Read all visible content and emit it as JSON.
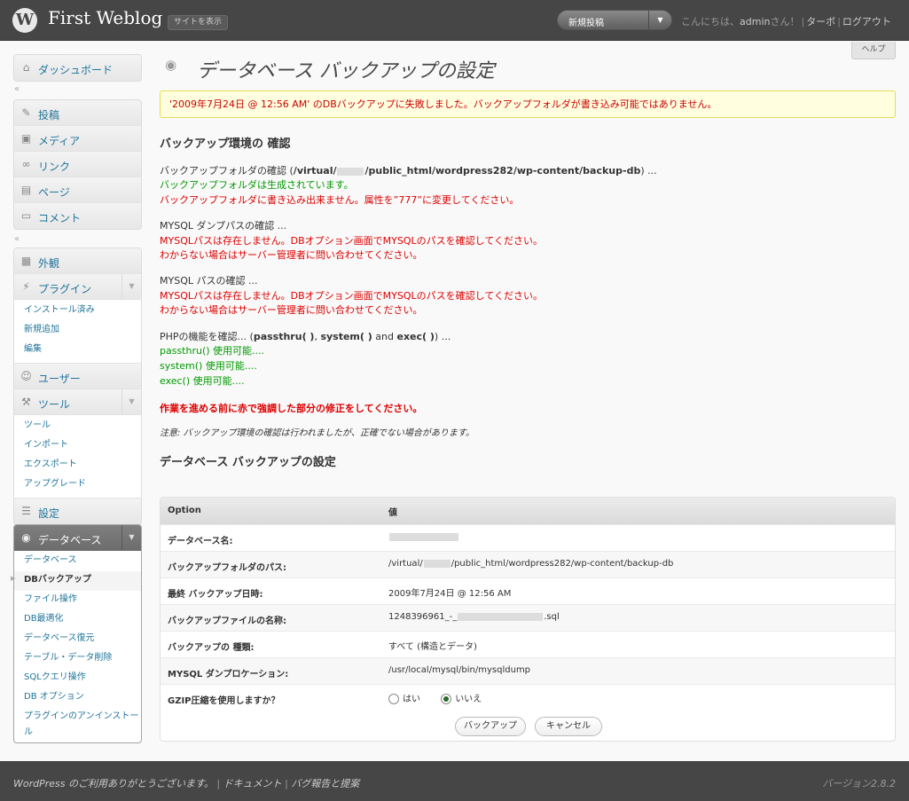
{
  "header": {
    "site_title": "First Weblog",
    "visit_site": "サイトを表示",
    "favorite_action": "新規投稿",
    "greeting_prefix": "こんにちは、",
    "username": "admin",
    "greeting_suffix": "さん！",
    "turbo": "ターボ",
    "logout": "ログアウト"
  },
  "help": "ヘルプ",
  "menu": {
    "dashboard": "ダッシュボード",
    "posts": "投稿",
    "media": "メディア",
    "links": "リンク",
    "pages": "ページ",
    "comments": "コメント",
    "appearance": "外観",
    "plugins": "プラグイン",
    "plugins_sub": [
      "インストール済み",
      "新規追加",
      "編集"
    ],
    "users": "ユーザー",
    "tools": "ツール",
    "tools_sub": [
      "ツール",
      "インポート",
      "エクスポート",
      "アップグレード"
    ],
    "settings": "設定",
    "database": "データベース",
    "database_sub": [
      "データベース",
      "DBバックアップ",
      "ファイル操作",
      "DB最適化",
      "データベース復元",
      "テーブル・データ削除",
      "SQLクエリ操作",
      "DB オプション",
      "プラグインのアンインストール"
    ]
  },
  "page": {
    "title": "データベース バックアップの設定",
    "error": "'2009年7月24日 @ 12:56 AM' のDBバックアップに失敗しました。バックアップフォルダが書き込み可能ではありません。",
    "check_heading": "バックアップ環境の 確認",
    "folder_check_pre": "バックアップフォルダの確認 (",
    "folder_path_a": "/virtual/",
    "folder_path_b": "/public_html/wordpress282/wp-content/backup-db",
    "folder_check_post": ") ...",
    "folder_ok": "バックアップフォルダは生成されています。",
    "folder_err": "バックアップフォルダに書き込み出来ません。属性を”777”に変更してください。",
    "mysqldump_check": "MYSQL ダンプパスの確認 ...",
    "mysqldump_err1": "MYSQLパスは存在しません。DBオプション画面でMYSQLのパスを確認してください。",
    "mysqldump_err2": "わからない場合はサーバー管理者に問い合わせてください。",
    "mysql_check": "MYSQL パスの確認 ...",
    "mysql_err1": "MYSQLパスは存在しません。DBオプション画面でMYSQLのパスを確認してください。",
    "mysql_err2": "わからない場合はサーバー管理者に問い合わせてください。",
    "php_check_pre": "PHPの機能を確認... (",
    "php_passthru": "passthru( )",
    "php_sep1": ", ",
    "php_system": "system( )",
    "php_and": " and ",
    "php_exec": "exec( )",
    "php_check_post": ") ...",
    "passthru_ok": "passthru() 使用可能....",
    "system_ok": "system() 使用可能....",
    "exec_ok": "exec() 使用可能....",
    "warning": "作業を進める前に赤で強調した部分の修正をしてください。",
    "note": "注意: バックアップ環境の確認は行われましたが、正確でない場合があります。",
    "settings_heading": "データベース バックアップの設定"
  },
  "table": {
    "col_option": "Option",
    "col_value": "値",
    "rows": [
      {
        "label": "データベース名:",
        "value": ""
      },
      {
        "label": "バックアップフォルダのパス:",
        "value_a": "/virtual/",
        "value_b": "/public_html/wordpress282/wp-content/backup-db"
      },
      {
        "label": "最終 バックアップ日時:",
        "value": "2009年7月24日 @ 12:56 AM"
      },
      {
        "label": "バックアップファイルの名称:",
        "value_a": "1248396961_-_",
        "value_b": ".sql"
      },
      {
        "label": "バックアップの 種類:",
        "value": "すべて (構造とデータ)"
      },
      {
        "label": "MYSQL ダンプロケーション:",
        "value": "/usr/local/mysql/bin/mysqldump"
      },
      {
        "label": "GZIP圧縮を使用しますか？",
        "radio_yes": "はい",
        "radio_no": "いいえ",
        "selected": "no"
      }
    ],
    "backup_button": "バックアップ",
    "cancel_button": "キャンセル"
  },
  "footer": {
    "thanks": "WordPress のご利用ありがとうございます。",
    "docs": "ドキュメント",
    "feedback": "バグ報告と提案",
    "version": "バージョン2.8.2"
  }
}
